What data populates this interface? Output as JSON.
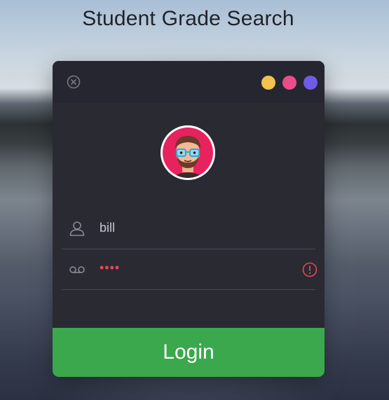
{
  "page": {
    "title": "Student Grade Search"
  },
  "window": {
    "close_icon": "close-icon",
    "theme_dots": [
      {
        "name": "yellow",
        "color": "#f2c14e"
      },
      {
        "name": "pink",
        "color": "#e84e8a"
      },
      {
        "name": "purple",
        "color": "#6e5ce8"
      }
    ]
  },
  "form": {
    "avatar_icon": "avatar",
    "username": {
      "icon": "user-icon",
      "value": "bill"
    },
    "password": {
      "icon": "voicemail-icon",
      "masked_value": "••••",
      "error_icon": "error-icon",
      "error_color": "#e5484d"
    },
    "login_label": "Login",
    "login_color": "#3ba84d"
  }
}
